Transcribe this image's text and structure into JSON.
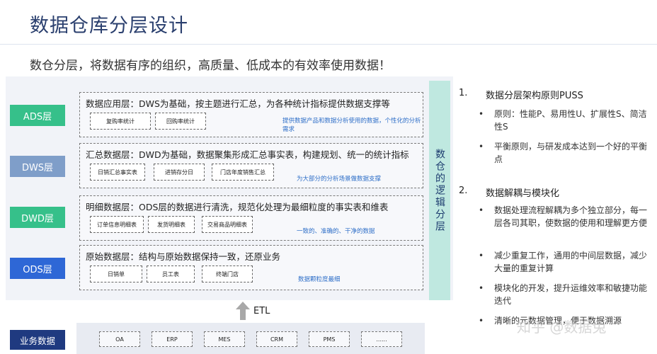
{
  "title": "数据仓库分层设计",
  "subtitle": "数仓分层，将数据有序的组织，高质量、低成本的有效率使用数据！",
  "side_label": "数仓的逻辑分层",
  "layers": {
    "ads": {
      "label": "ADS层",
      "heading": "数据应用层：DWS为基础，按主题进行汇总，为各种统计指标提供数据支撑等",
      "chips": [
        "复购率统计",
        "回购率统计"
      ],
      "note": "提供数据产品和数据分析使用的数据，个性化的分析需求"
    },
    "dws": {
      "label": "DWS层",
      "heading": "汇总数据层：DWD为基础，数据聚集形成汇总事实表，构建规划、统一的统计指标",
      "chips": [
        "日销汇总事实表",
        "进销存分日",
        "门店年度销售汇总"
      ],
      "note": "为大部分的分析场景做数据支撑"
    },
    "dwd": {
      "label": "DWD层",
      "heading": "明细数据层：ODS层的数据进行清洗，规范化处理为最细粒度的事实表和维表",
      "chips": [
        "订单信息明细表",
        "发货明细表",
        "交易商品明细表"
      ],
      "note": "一致的、准确的、干净的数据"
    },
    "ods": {
      "label": "ODS层",
      "heading": "原始数据层：结构与原始数据保持一致，还原业务",
      "chips": [
        "日销单",
        "员工表",
        "终端门店"
      ],
      "note": "数据颗粒度最细"
    }
  },
  "etl_label": "ETL",
  "business": {
    "label": "业务数据",
    "sources": [
      "OA",
      "ERP",
      "MES",
      "CRM",
      "PMS",
      "......"
    ]
  },
  "principles": [
    {
      "num": "1.",
      "title": "数据分层架构原则PUSS",
      "bullets": [
        "原则：性能P、易用性U、扩展性S、简洁性S",
        "平衡原则，与研发成本达到一个好的平衡点"
      ]
    },
    {
      "num": "2.",
      "title": "数据解耦与模块化",
      "bullets": [
        "数据处理流程解耦为多个独立部分，每一层各司其职，使数据的使用和理解更方便",
        "减少重复工作，通用的中间层数据，减少大量的重复计算",
        "模块化的开发，提升运维效率和敏捷功能迭代",
        "清晰的元数据管理，便于数据溯源"
      ]
    }
  ],
  "watermark": "知乎 @数据兔"
}
